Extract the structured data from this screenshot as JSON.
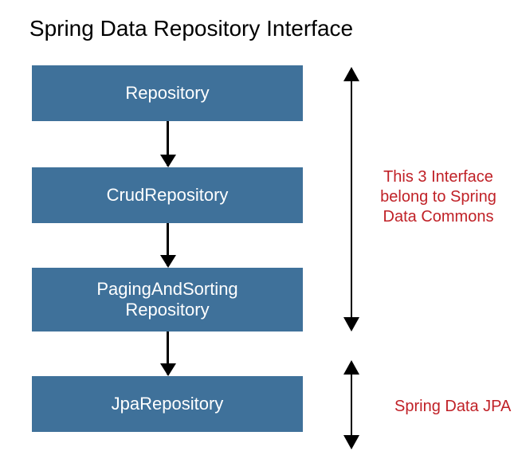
{
  "title": "Spring Data Repository Interface",
  "blocks": {
    "b0": "Repository",
    "b1": "CrudRepository",
    "b2_line1": "PagingAndSorting",
    "b2_line2": "Repository",
    "b3": "JpaRepository"
  },
  "annotations": {
    "a0_line1": "This 3 Interface",
    "a0_line2": "belong to Spring",
    "a0_line3": "Data Commons",
    "a1": "Spring Data JPA"
  },
  "colors": {
    "block_bg": "#3f719a",
    "annotation_text": "#c02127"
  }
}
